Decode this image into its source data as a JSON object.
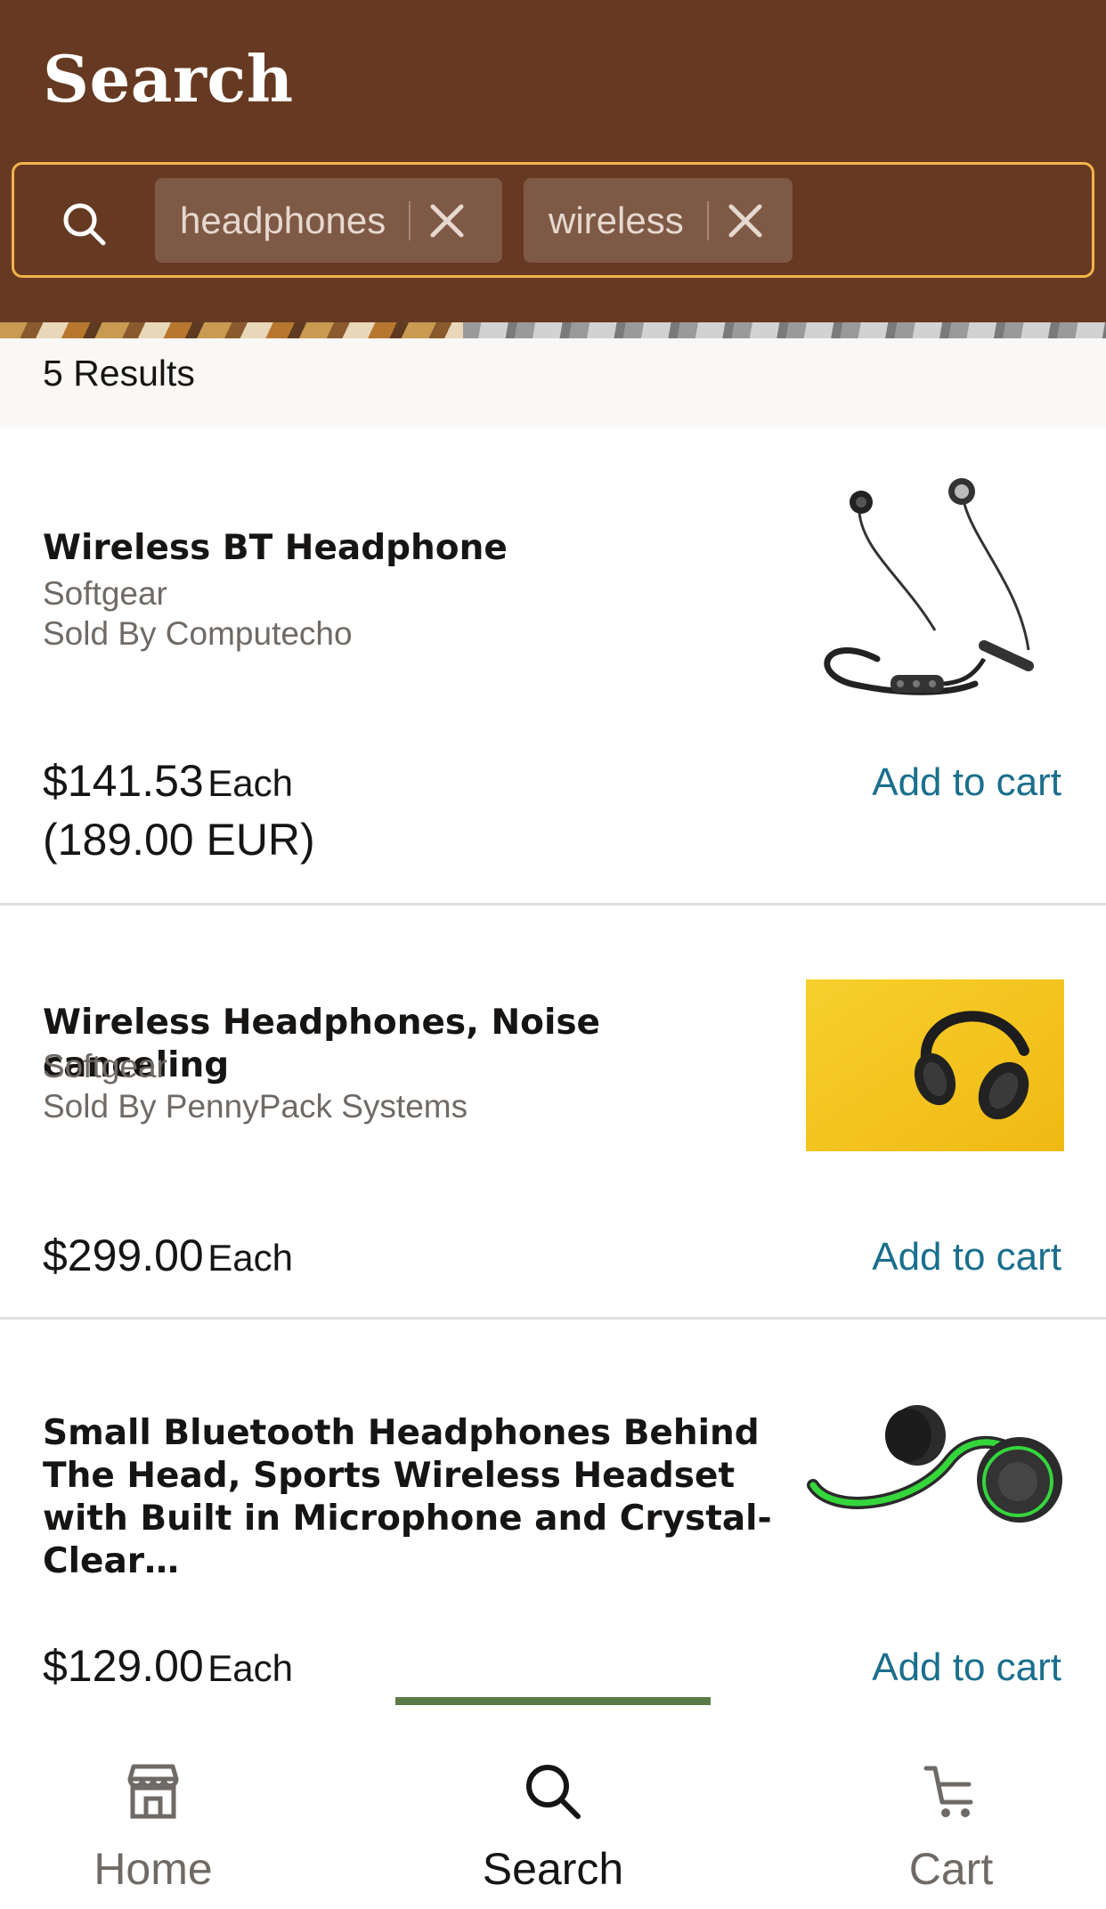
{
  "header": {
    "title": "Search",
    "search_chips": [
      {
        "label": "headphones"
      },
      {
        "label": "wireless"
      }
    ]
  },
  "results": {
    "count_label": "5 Results"
  },
  "products": [
    {
      "name": "Wireless BT Headphone",
      "brand": "Softgear",
      "seller": "Sold By Computecho",
      "price": "$141.53",
      "unit": "Each",
      "alt_price": "(189.00 EUR)",
      "action": "Add to cart",
      "image_icon": "neckband-earphones-image"
    },
    {
      "name": "Wireless Headphones, Noise canceling",
      "brand": "Softgear",
      "seller": "Sold By PennyPack Systems",
      "price": "$299.00",
      "unit": "Each",
      "action": "Add to cart",
      "image_icon": "over-ear-headphones-image"
    },
    {
      "name": "Small Bluetooth Headphones Behind The Head, Sports Wireless Headset with Built in Microphone and Crystal-Clear…",
      "price": "$129.00",
      "unit": "Each",
      "action": "Add to cart",
      "image_icon": "sport-headset-image"
    }
  ],
  "bottom_nav": {
    "items": [
      {
        "label": "Home",
        "icon": "store-icon",
        "active": false
      },
      {
        "label": "Search",
        "icon": "search-icon",
        "active": true
      },
      {
        "label": "Cart",
        "icon": "cart-icon",
        "active": false
      }
    ]
  },
  "colors": {
    "header_bg": "#663a22",
    "search_border": "#f2b44a",
    "link": "#1a6f8c",
    "active_tab": "#5a7a46",
    "image_bg_yellow": "#f5c51a",
    "headset_green": "#35d63c"
  }
}
